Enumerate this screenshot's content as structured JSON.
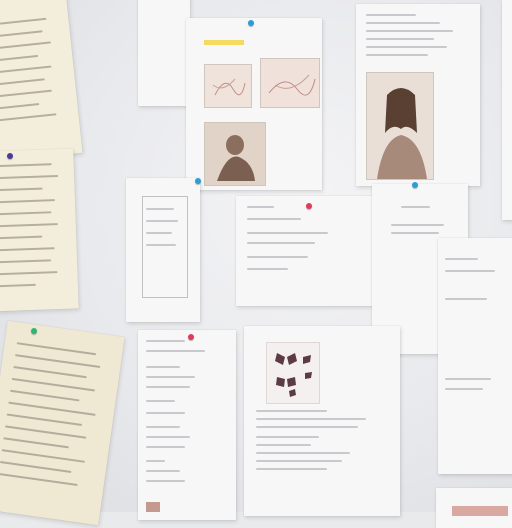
{
  "scene": {
    "description_colors": {
      "wall": "#e9eaec",
      "paper": "#f7f7f8",
      "cream_paper": "#f3eedc",
      "pin_blue": "#2a9fd6",
      "pin_red": "#e23a5a",
      "pin_green": "#2bb673",
      "pin_purple": "#4a3a9a",
      "highlight_yellow": "#f4d23c"
    },
    "pins": [
      {
        "name": "pin-blue-top",
        "color": "pin_blue"
      },
      {
        "name": "pin-blue-mid-left",
        "color": "pin_blue"
      },
      {
        "name": "pin-red-center",
        "color": "pin_red"
      },
      {
        "name": "pin-blue-right",
        "color": "pin_blue"
      },
      {
        "name": "pin-green-left",
        "color": "pin_green"
      },
      {
        "name": "pin-red-bottom",
        "color": "pin_red"
      },
      {
        "name": "pin-purple-left",
        "color": "pin_purple"
      }
    ]
  }
}
